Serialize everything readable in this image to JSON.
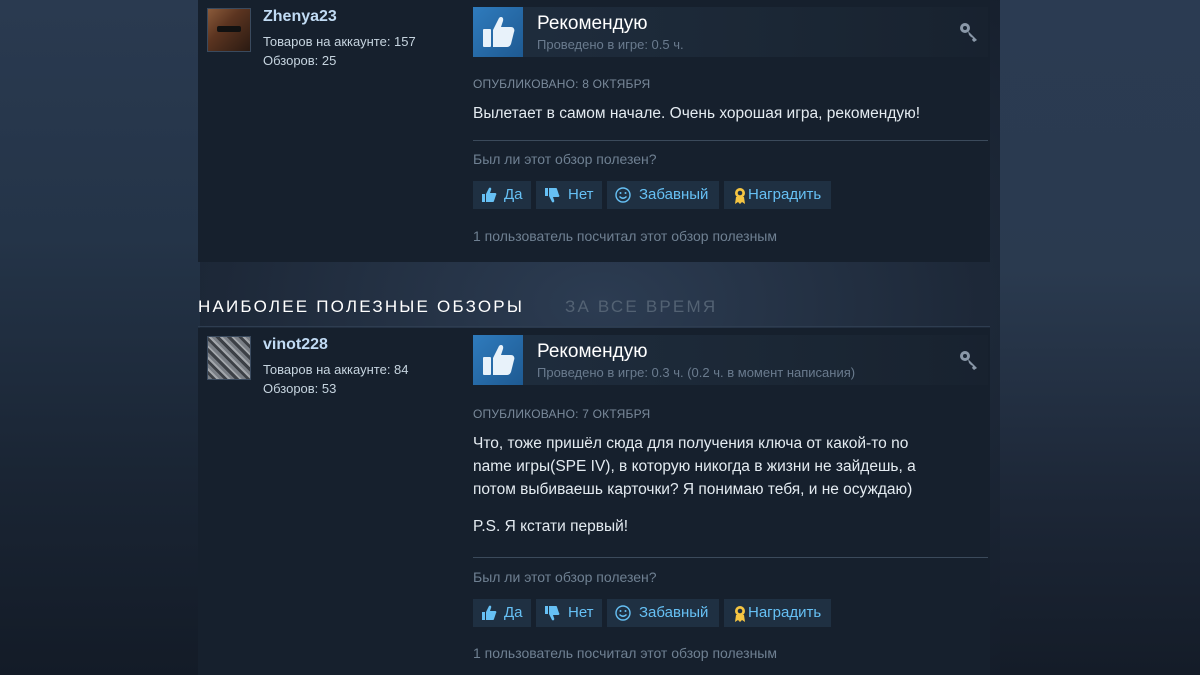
{
  "reviews": [
    {
      "author": {
        "name": "Zhenya23",
        "products": "Товаров на аккаунте: 157",
        "reviews": "Обзоров: 25"
      },
      "verdict": "Рекомендую",
      "hours": "Проведено в игре: 0.5 ч.",
      "posted": "ОПУБЛИКОВАНО: 8 ОКТЯБРЯ",
      "body": [
        "Вылетает в самом начале. Очень хорошая игра, рекомендую!"
      ],
      "helpful_question": "Был ли этот обзор полезен?",
      "buttons": {
        "yes": "Да",
        "no": "Нет",
        "funny": "Забавный",
        "award": "Наградить"
      },
      "helpful_count": "1 пользователь посчитал этот обзор полезным"
    },
    {
      "author": {
        "name": "vinot228",
        "products": "Товаров на аккаунте: 84",
        "reviews": "Обзоров: 53"
      },
      "verdict": "Рекомендую",
      "hours": "Проведено в игре: 0.3 ч. (0.2 ч. в момент написания)",
      "posted": "ОПУБЛИКОВАНО: 7 ОКТЯБРЯ",
      "body": [
        "Что, тоже пришёл сюда для получения ключа от какой-то no",
        "name игры(SPE IV), в которую никогда в жизни не зайдешь, а",
        "потом выбиваешь карточки? Я понимаю тебя, и не осуждаю)",
        "P.S. Я кстати первый!"
      ],
      "helpful_question": "Был ли этот обзор полезен?",
      "buttons": {
        "yes": "Да",
        "no": "Нет",
        "funny": "Забавный",
        "award": "Наградить"
      },
      "helpful_count": "1 пользователь посчитал этот обзор полезным"
    }
  ],
  "section": {
    "title": "НАИБОЛЕЕ ПОЛЕЗНЫЕ ОБЗОРЫ",
    "filter": "ЗА ВСЕ ВРЕМЯ"
  },
  "colors": {
    "accent": "#66c0f4",
    "thumb": "#2f7bbd",
    "award": "#f5c542",
    "panel": "#16202d"
  }
}
